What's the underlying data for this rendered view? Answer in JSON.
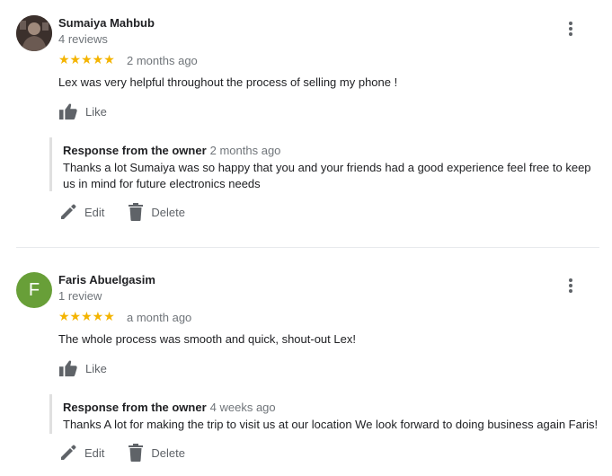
{
  "reviews": [
    {
      "author": "Sumaiya Mahbub",
      "review_count": "4 reviews",
      "stars": "★★★★★",
      "rating": 5,
      "time_ago": "2 months ago",
      "text": "Lex was very helpful throughout the process of selling my phone !",
      "like_label": "Like",
      "response": {
        "title": "Response from the owner",
        "time_ago": "2 months ago",
        "text": "Thanks a lot Sumaiya was so happy that you and your friends had a good experience feel free to keep us in mind for future electronics needs"
      },
      "edit_label": "Edit",
      "delete_label": "Delete"
    },
    {
      "author": "Faris Abuelgasim",
      "avatar_letter": "F",
      "review_count": "1 review",
      "stars": "★★★★★",
      "rating": 5,
      "time_ago": "a month ago",
      "text": "The whole process was smooth and quick, shout-out Lex!",
      "like_label": "Like",
      "response": {
        "title": "Response from the owner",
        "time_ago": "4 weeks ago",
        "text": "Thanks A lot for making the trip to visit us at our location We look forward to doing business again Faris!"
      },
      "edit_label": "Edit",
      "delete_label": "Delete"
    }
  ],
  "colors": {
    "star": "#f4b400",
    "avatar_green": "#689f38",
    "icon_gray": "#5f6368",
    "secondary_text": "#70757a"
  },
  "icons": [
    "more-vert-icon",
    "thumb-up-icon",
    "pencil-icon",
    "trash-icon"
  ]
}
